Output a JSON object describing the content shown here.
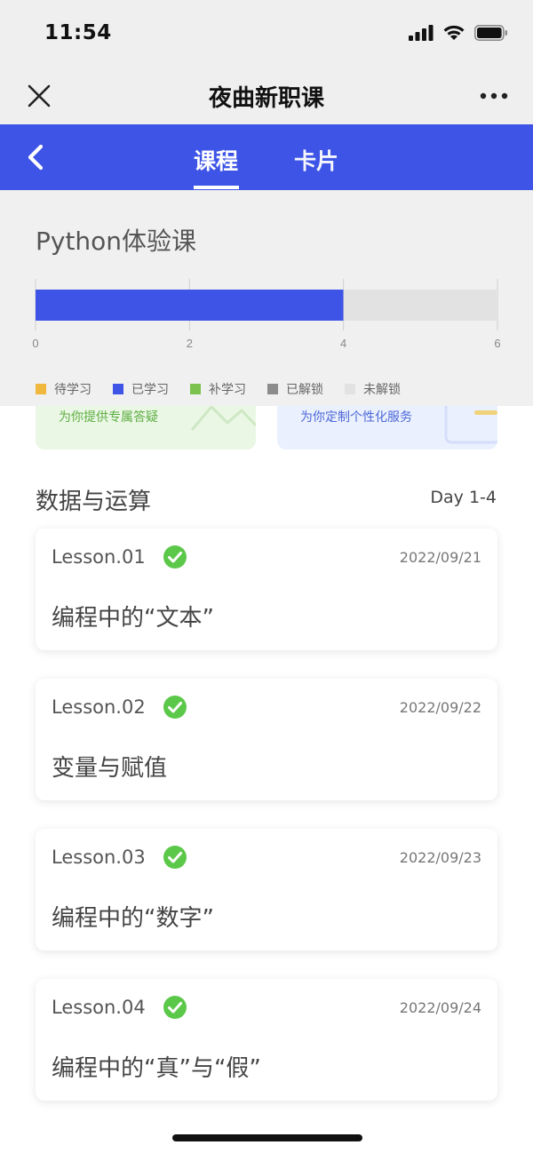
{
  "status_bar": {
    "time": "11:54"
  },
  "title_bar": {
    "title": "夜曲新职课"
  },
  "tabs": [
    {
      "label": "课程",
      "active": true
    },
    {
      "label": "卡片",
      "active": false
    }
  ],
  "promo": {
    "left_text": "为你提供专属答疑",
    "right_text": "为你定制个性化服务"
  },
  "section": {
    "title": "数据与运算",
    "range": "Day 1-4"
  },
  "lessons": [
    {
      "number": "Lesson.01",
      "date": "2022/09/21",
      "title": "编程中的“文本”",
      "completed": true
    },
    {
      "number": "Lesson.02",
      "date": "2022/09/22",
      "title": "变量与赋值",
      "completed": true
    },
    {
      "number": "Lesson.03",
      "date": "2022/09/23",
      "title": "编程中的“数字”",
      "completed": true
    },
    {
      "number": "Lesson.04",
      "date": "2022/09/24",
      "title": "编程中的“真”与“假”",
      "completed": true
    }
  ],
  "chart_data": {
    "type": "bar",
    "orientation": "horizontal",
    "stacked": true,
    "title": "Python体验课",
    "xlim": [
      0,
      6
    ],
    "x_ticks": [
      "0",
      "2",
      "4",
      "6"
    ],
    "grid": true,
    "legend_position": "bottom",
    "series": [
      {
        "name": "待学习",
        "color": "#f0b83c",
        "value": 0
      },
      {
        "name": "已学习",
        "color": "#3d54e6",
        "value": 4
      },
      {
        "name": "补学习",
        "color": "#7bc24f",
        "value": 0
      },
      {
        "name": "已解锁",
        "color": "#8c8c8c",
        "value": 0
      },
      {
        "name": "未解锁",
        "color": "#e2e2e2",
        "value": 2
      }
    ]
  },
  "colors": {
    "accent": "#3d54e6",
    "success": "#5cc84a"
  }
}
